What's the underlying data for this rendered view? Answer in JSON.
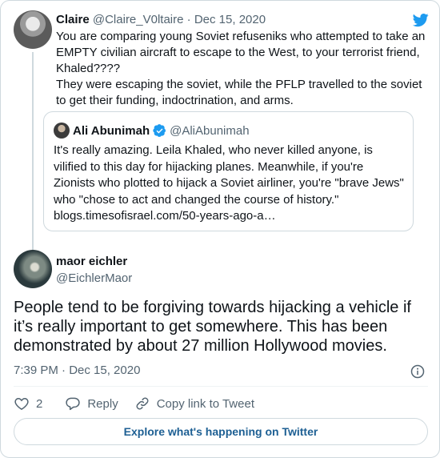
{
  "parent_tweet": {
    "author_name": "Claire",
    "author_handle": "@Claire_V0ltaire",
    "separator": " · ",
    "date": "Dec 15, 2020",
    "lines": [
      "You are comparing young Soviet refuseniks who attempted to take an EMPTY civilian aircraft to escape to the West, to your terrorist friend, Khaled????",
      "They were escaping the soviet, while the PFLP travelled to the soviet to get their funding, indoctrination, and arms."
    ]
  },
  "quoted_tweet": {
    "author_name": "Ali Abunimah",
    "author_handle": "@AliAbunimah",
    "text": "It's really amazing. Leila Khaled, who never killed anyone, is vilified to this day for hijacking planes. Meanwhile, if you're Zionists who plotted to hijack a Soviet airliner, you're \"brave Jews\" who \"chose to act and changed the course of history.\" blogs.timesofisrael.com/50-years-ago-a…"
  },
  "main_tweet": {
    "author_name": "maor eichler",
    "author_handle": "@EichlerMaor",
    "text": "People tend to be forgiving towards hijacking a vehicle if it’s really important to get somewhere. This has been demonstrated by about 27 million Hollywood movies.",
    "timestamp": "7:39 PM · Dec 15, 2020"
  },
  "actions": {
    "like_count": "2",
    "reply_label": "Reply",
    "copy_link_label": "Copy link to Tweet"
  },
  "explore_button_label": "Explore what's happening on Twitter",
  "colors": {
    "twitter_blue": "#1d9bf0",
    "text_primary": "#0f1419",
    "text_secondary": "#536471",
    "border": "#cfd9de",
    "explore_text": "#1d5f93"
  },
  "icons": {
    "brand": "twitter-bird-icon",
    "verified": "verified-badge-icon",
    "info": "info-icon",
    "like": "heart-icon",
    "reply": "speech-bubble-icon",
    "copy_link": "link-icon"
  }
}
